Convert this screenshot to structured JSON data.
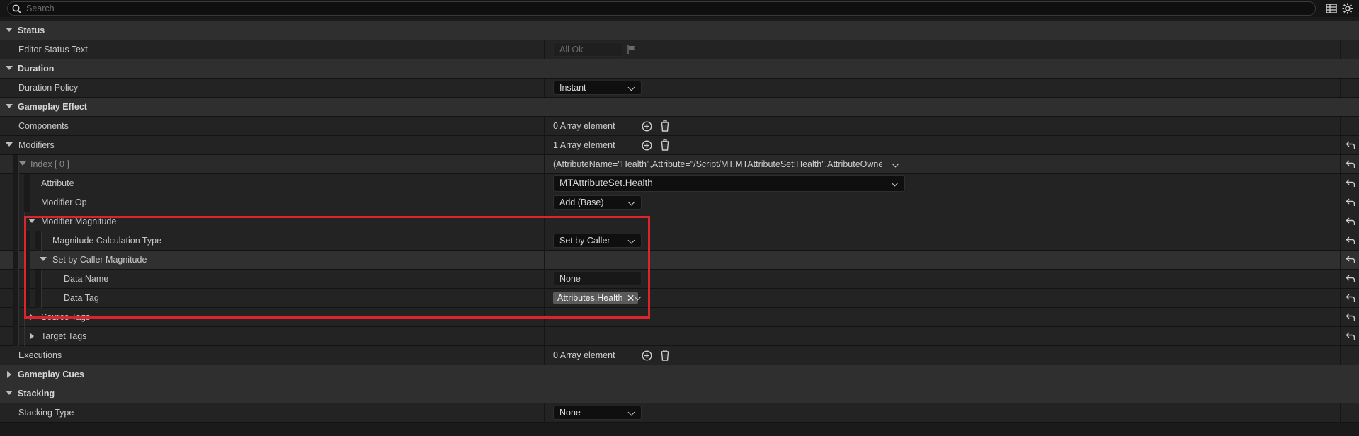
{
  "search": {
    "placeholder": "Search"
  },
  "rows": {
    "status": {
      "label": "Status"
    },
    "editor_status_text": {
      "label": "Editor Status Text",
      "value": "All Ok"
    },
    "duration": {
      "label": "Duration"
    },
    "duration_policy": {
      "label": "Duration Policy",
      "value": "Instant"
    },
    "gameplay_effect": {
      "label": "Gameplay Effect"
    },
    "components": {
      "label": "Components",
      "value": "0 Array element"
    },
    "modifiers": {
      "label": "Modifiers",
      "value": "1 Array element"
    },
    "index0": {
      "label": "Index [ 0 ]",
      "value": "(AttributeName=\"Health\",Attribute=\"/Script/MT.MTAttributeSet:Health\",AttributeOwner=\"/S"
    },
    "attribute": {
      "label": "Attribute",
      "value": "MTAttributeSet.Health"
    },
    "modifier_op": {
      "label": "Modifier Op",
      "value": "Add (Base)"
    },
    "modifier_magnitude": {
      "label": "Modifier Magnitude"
    },
    "magnitude_calc_type": {
      "label": "Magnitude Calculation Type",
      "value": "Set by Caller"
    },
    "set_by_caller_magnitude": {
      "label": "Set by Caller Magnitude"
    },
    "data_name": {
      "label": "Data Name",
      "value": "None"
    },
    "data_tag": {
      "label": "Data Tag",
      "value": "Attributes.Health"
    },
    "source_tags": {
      "label": "Source Tags"
    },
    "target_tags": {
      "label": "Target Tags"
    },
    "executions": {
      "label": "Executions",
      "value": "0 Array element"
    },
    "gameplay_cues": {
      "label": "Gameplay Cues"
    },
    "stacking": {
      "label": "Stacking"
    },
    "stacking_type": {
      "label": "Stacking Type",
      "value": "None"
    }
  },
  "colors": {
    "highlight": "#d8262c",
    "background": "#1a1a1a"
  },
  "icons": [
    "search-icon",
    "table-view-icon",
    "settings-gear-icon",
    "reset-arrow-icon",
    "add-element-icon",
    "delete-trash-icon",
    "flag-icon",
    "chevron-down-icon",
    "expand-arrow-icon"
  ]
}
